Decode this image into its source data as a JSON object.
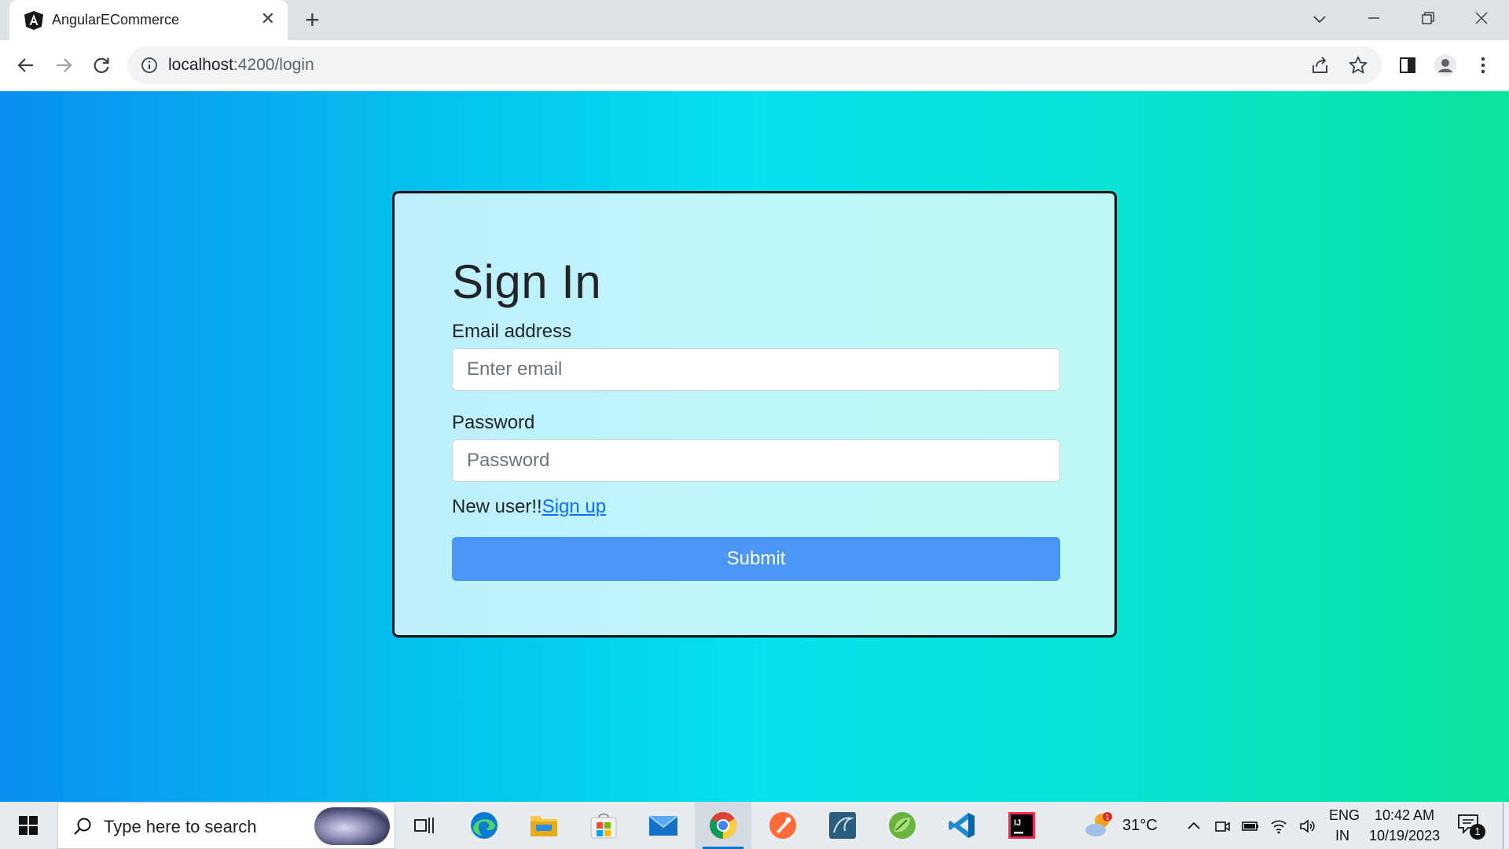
{
  "browser": {
    "tab_title": "AngularECommerce",
    "tab_close": "✕",
    "new_tab": "+",
    "url_host": "localhost",
    "url_path": ":4200/login"
  },
  "login": {
    "title": "Sign In",
    "email_label": "Email address",
    "email_placeholder": "Enter email",
    "password_label": "Password",
    "password_placeholder": "Password",
    "new_user_text": "New user!!",
    "signup_link": "Sign up",
    "submit_label": "Submit"
  },
  "taskbar": {
    "search_placeholder": "Type here to search",
    "weather_temp": "31°C",
    "weather_badge": "1",
    "language_top": "ENG",
    "language_bottom": "IN",
    "time": "10:42 AM",
    "date": "10/19/2023",
    "notification_count": "1"
  },
  "colors": {
    "page_gradient_start": "#0a8ff0",
    "page_gradient_end": "#0ae49c",
    "submit_button": "#4a96f5",
    "link": "#0d6efd"
  }
}
